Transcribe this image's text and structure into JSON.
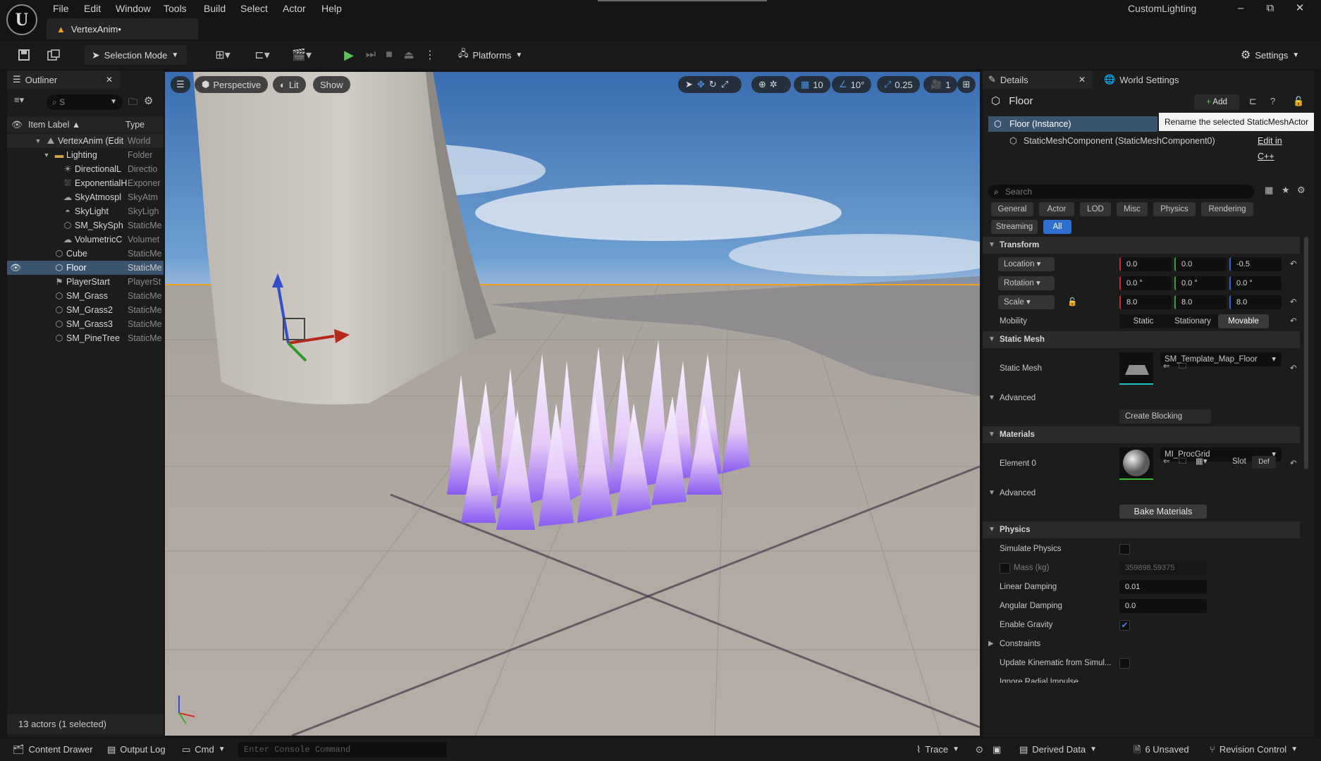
{
  "app": {
    "project": "CustomLighting",
    "doc_tab": "VertexAnim•"
  },
  "menu": [
    "File",
    "Edit",
    "Window",
    "Tools",
    "Build",
    "Select",
    "Actor",
    "Help"
  ],
  "window_controls": {
    "minimize": "–",
    "maximize": "⧉",
    "close": "✕"
  },
  "toolbar": {
    "selection_mode": "Selection Mode",
    "platforms": "Platforms",
    "settings": "Settings"
  },
  "outliner": {
    "tab": "Outliner",
    "search_placeholder": "S",
    "col_label": "Item Label ▲",
    "col_type": "Type",
    "rows": [
      {
        "label": "VertexAnim (Edit",
        "type": "World"
      },
      {
        "label": "Lighting",
        "type": "Folder"
      },
      {
        "label": "DirectionalL",
        "type": "Directio"
      },
      {
        "label": "ExponentialH",
        "type": "Exponer"
      },
      {
        "label": "SkyAtmospl",
        "type": "SkyAtm"
      },
      {
        "label": "SkyLight",
        "type": "SkyLigh"
      },
      {
        "label": "SM_SkySph",
        "type": "StaticMe"
      },
      {
        "label": "VolumetricC",
        "type": "Volumet"
      },
      {
        "label": "Cube",
        "type": "StaticMe"
      },
      {
        "label": "Floor",
        "type": "StaticMe"
      },
      {
        "label": "PlayerStart",
        "type": "PlayerSt"
      },
      {
        "label": "SM_Grass",
        "type": "StaticMe"
      },
      {
        "label": "SM_Grass2",
        "type": "StaticMe"
      },
      {
        "label": "SM_Grass3",
        "type": "StaticMe"
      },
      {
        "label": "SM_PineTree",
        "type": "StaticMe"
      }
    ],
    "footer": "13 actors (1 selected)"
  },
  "viewport": {
    "perspective": "Perspective",
    "lit": "Lit",
    "show": "Show",
    "grid_snap": "10",
    "rot_snap": "10°",
    "scale_snap": "0.25",
    "cam_speed": "1"
  },
  "details": {
    "tab": "Details",
    "tab2": "World Settings",
    "actor_name": "Floor",
    "add": "Add",
    "tooltip": "Rename the selected StaticMeshActor",
    "instance": "Floor (Instance)",
    "component": "StaticMeshComponent (StaticMeshComponent0)",
    "edit_cpp": "Edit in C++",
    "search_placeholder": "Search",
    "filters": [
      "General",
      "Actor",
      "LOD",
      "Misc",
      "Physics",
      "Rendering",
      "Streaming",
      "All"
    ],
    "transform": {
      "section": "Transform",
      "location_label": "Location",
      "location": [
        "0.0",
        "0.0",
        "-0.5"
      ],
      "rotation_label": "Rotation",
      "rotation": [
        "0.0 °",
        "0.0 °",
        "0.0 °"
      ],
      "scale_label": "Scale",
      "scale": [
        "8.0",
        "8.0",
        "8.0"
      ],
      "mobility_label": "Mobility",
      "mobility": [
        "Static",
        "Stationary",
        "Movable"
      ]
    },
    "static_mesh": {
      "section": "Static Mesh",
      "label": "Static Mesh",
      "value": "SM_Template_Map_Floor",
      "advanced": "Advanced",
      "blocking": "Create Blocking Volume"
    },
    "materials": {
      "section": "Materials",
      "label": "Element 0",
      "value": "MI_ProcGrid",
      "slot": "Slot",
      "slot_value": "Def",
      "advanced": "Advanced",
      "bake": "Bake Materials"
    },
    "physics": {
      "section": "Physics",
      "simulate": "Simulate Physics",
      "mass": "Mass (kg)",
      "mass_value": "359898.59375",
      "linear_label": "Linear Damping",
      "linear": "0.01",
      "angular_label": "Angular Damping",
      "angular": "0.0",
      "gravity": "Enable Gravity",
      "constraints": "Constraints",
      "kinematic": "Update Kinematic from Simul...",
      "radial": "Ignore Radial Impulse"
    }
  },
  "statusbar": {
    "content_drawer": "Content Drawer",
    "output_log": "Output Log",
    "cmd": "Cmd",
    "console_placeholder": "Enter Console Command",
    "trace": "Trace",
    "derived_data": "Derived Data",
    "unsaved": "6 Unsaved",
    "revision": "Revision Control"
  }
}
